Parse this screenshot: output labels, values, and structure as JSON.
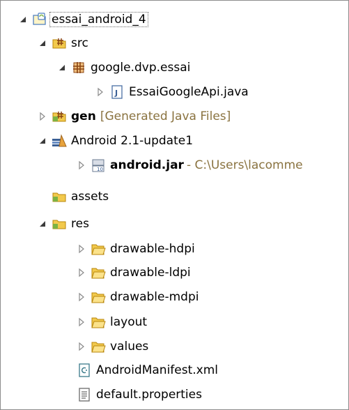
{
  "tree": {
    "project": {
      "label": "essai_android_4"
    },
    "src": {
      "label": "src"
    },
    "package": {
      "label": "google.dvp.essai"
    },
    "java_file": {
      "label": "EssaiGoogleApi.java"
    },
    "gen": {
      "label": "gen",
      "decoration": "[Generated Java Files]"
    },
    "library": {
      "label": "Android 2.1-update1"
    },
    "jar": {
      "label": "android.jar",
      "decoration": "- C:\\Users\\lacomme"
    },
    "assets": {
      "label": "assets"
    },
    "res": {
      "label": "res"
    },
    "drawable_hdpi": {
      "label": "drawable-hdpi"
    },
    "drawable_ldpi": {
      "label": "drawable-ldpi"
    },
    "drawable_mdpi": {
      "label": "drawable-mdpi"
    },
    "layout": {
      "label": "layout"
    },
    "values": {
      "label": "values"
    },
    "manifest": {
      "label": "AndroidManifest.xml"
    },
    "properties": {
      "label": "default.properties"
    }
  },
  "colors": {
    "decoration": "#8a7340",
    "folder": "#f2c94c",
    "selection_border": "#6a6a6a"
  },
  "icons": {
    "expanded": "triangle-down",
    "collapsed": "triangle-right"
  }
}
